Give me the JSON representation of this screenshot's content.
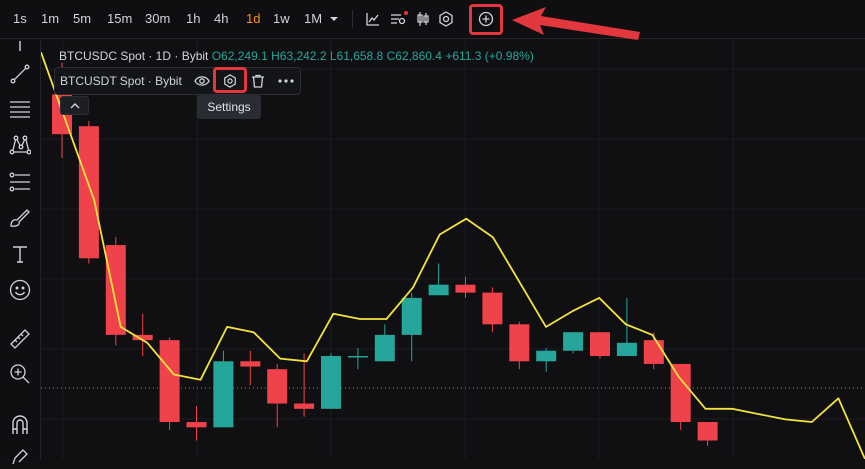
{
  "toolbar": {
    "timeframes": [
      "1s",
      "1m",
      "5m",
      "15m",
      "30m",
      "1h",
      "4h",
      "1d",
      "1w",
      "1M"
    ],
    "active_timeframe": "1d",
    "icons": [
      "chevron-down-icon",
      "line-chart-icon",
      "indicators-icon",
      "candles-icon",
      "settings-icon",
      "add-icon"
    ]
  },
  "left_tools": [
    "crosshair-icon",
    "trend-line-icon",
    "horizontal-lines-icon",
    "pattern-icon",
    "fib-retracement-icon",
    "brush-icon",
    "text-icon",
    "emoji-icon",
    "ruler-icon",
    "zoom-in-icon",
    "magnet-icon",
    "pencil-icon"
  ],
  "legend_main": {
    "name": "BTCUSDC Spot · 1D · Bybit",
    "open": "O62,249.1",
    "high": "H63,242.2",
    "low": "L61,658.8",
    "close": "C62,860.4",
    "change": "+611.3 (+0.98%)"
  },
  "legend_compare": {
    "name": "BTCUSDT Spot · Bybit",
    "icons": [
      "eye-icon",
      "settings-icon",
      "trash-icon",
      "more-icon"
    ]
  },
  "tooltip": "Settings",
  "colors": {
    "up": "#26a69a",
    "down": "#f0424b",
    "line": "#f5e33b",
    "accent": "#f7931a",
    "highlight": "#e2373c",
    "background": "#101013"
  },
  "chart_data": {
    "type": "candlestick",
    "series": [
      {
        "name": "BTCUSDC Spot · 1D · Bybit",
        "candles": [
          {
            "o": 67000,
            "h": 68200,
            "l": 64600,
            "c": 65500
          },
          {
            "o": 65800,
            "h": 66000,
            "l": 60600,
            "c": 60800
          },
          {
            "o": 61300,
            "h": 61600,
            "l": 57500,
            "c": 57900
          },
          {
            "o": 57900,
            "h": 58700,
            "l": 57100,
            "c": 57700
          },
          {
            "o": 57700,
            "h": 57800,
            "l": 54300,
            "c": 54600
          },
          {
            "o": 54600,
            "h": 55200,
            "l": 53900,
            "c": 54400
          },
          {
            "o": 54400,
            "h": 57300,
            "l": 54400,
            "c": 56900
          },
          {
            "o": 56900,
            "h": 57300,
            "l": 56000,
            "c": 56700
          },
          {
            "o": 56600,
            "h": 56800,
            "l": 54400,
            "c": 55300
          },
          {
            "o": 55300,
            "h": 57200,
            "l": 54800,
            "c": 55100
          },
          {
            "o": 55100,
            "h": 57200,
            "l": 55100,
            "c": 57100
          },
          {
            "o": 57100,
            "h": 57400,
            "l": 56600,
            "c": 57100
          },
          {
            "o": 56900,
            "h": 58300,
            "l": 56900,
            "c": 57900
          },
          {
            "o": 57900,
            "h": 59500,
            "l": 56900,
            "c": 59300
          },
          {
            "o": 59400,
            "h": 60600,
            "l": 59400,
            "c": 59800
          },
          {
            "o": 59800,
            "h": 60100,
            "l": 59300,
            "c": 59500
          },
          {
            "o": 59500,
            "h": 59700,
            "l": 58000,
            "c": 58300
          },
          {
            "o": 58300,
            "h": 58400,
            "l": 56600,
            "c": 56900
          },
          {
            "o": 56900,
            "h": 57400,
            "l": 56500,
            "c": 57300
          },
          {
            "o": 57300,
            "h": 58000,
            "l": 57200,
            "c": 58000
          },
          {
            "o": 58000,
            "h": 58000,
            "l": 57000,
            "c": 57100
          },
          {
            "o": 57100,
            "h": 59300,
            "l": 57100,
            "c": 57600
          },
          {
            "o": 57700,
            "h": 58000,
            "l": 56600,
            "c": 56800
          },
          {
            "o": 56800,
            "h": 56800,
            "l": 54300,
            "c": 54600
          },
          {
            "o": 54600,
            "h": 54600,
            "l": 53700,
            "c": 53900
          }
        ]
      },
      {
        "name": "BTCUSDT Spot · Bybit",
        "type": "line",
        "values": [
          68600,
          65800,
          63000,
          58200,
          57600,
          56400,
          56200,
          58200,
          58000,
          57000,
          56900,
          58700,
          58500,
          58500,
          59700,
          61700,
          62300,
          61600,
          59900,
          58200,
          58800,
          59300,
          58300,
          57900,
          56300,
          55100,
          55100,
          54900,
          54700,
          54600,
          55500,
          53200
        ]
      }
    ],
    "price_min": 53200,
    "price_max": 68800
  }
}
